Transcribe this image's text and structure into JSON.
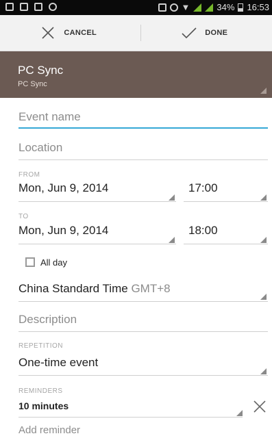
{
  "statusbar": {
    "battery": "34%",
    "time": "16:53"
  },
  "actions": {
    "cancel": "CANCEL",
    "done": "DONE"
  },
  "calendar": {
    "name": "PC Sync",
    "sub": "PC Sync"
  },
  "fields": {
    "event_name": "Event name",
    "location": "Location",
    "from_label": "FROM",
    "from_date": "Mon, Jun 9, 2014",
    "from_time": "17:00",
    "to_label": "TO",
    "to_date": "Mon, Jun 9, 2014",
    "to_time": "18:00",
    "all_day": "All day",
    "timezone": "China Standard Time",
    "timezone_gmt": "GMT+8",
    "description": "Description",
    "repetition_label": "REPETITION",
    "repetition": "One-time event",
    "reminders_label": "REMINDERS",
    "reminder": "10 minutes",
    "add_reminder": "Add reminder"
  },
  "colors": {
    "accent": "#35a8d6",
    "calendar_bar": "#6b5a53",
    "signal": "#77b82b"
  }
}
